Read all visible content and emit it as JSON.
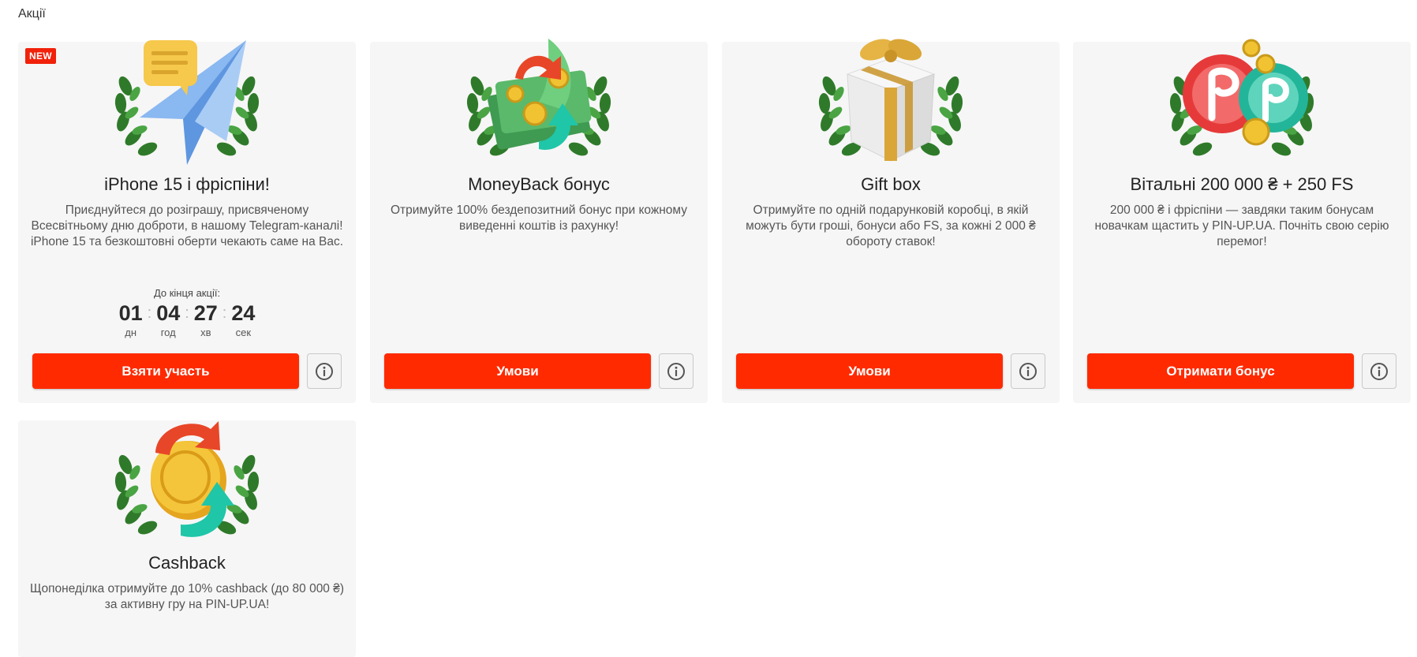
{
  "page": {
    "title": "Акції"
  },
  "badges": {
    "new": "NEW"
  },
  "colors": {
    "accent": "#ff2a00",
    "badge": "#f1210a",
    "card_bg": "#f6f6f6"
  },
  "promos": [
    {
      "title": "iPhone 15 і фріспіни!",
      "description": "Приєднуйтеся до розіграшу, присвяченому Всесвітньому дню доброти, в нашому Telegram-каналі! iPhone 15 та безкоштовні оберти чекають саме на Вас.",
      "button": "Взяти участь",
      "icon": "paper-plane-icon",
      "timer": {
        "label": "До кінця акції:",
        "days": "01",
        "hours": "04",
        "minutes": "27",
        "seconds": "24",
        "days_label": "дн",
        "hours_label": "год",
        "minutes_label": "хв",
        "seconds_label": "сек"
      }
    },
    {
      "title": "MoneyBack бонус",
      "description": "Отримуйте 100% бездепозитний бонус при кожному виведенні коштів із рахунку!",
      "button": "Умови",
      "icon": "money-stack-icon"
    },
    {
      "title": "Gift box",
      "description": "Отримуйте по одній подарунковій коробці, в якій можуть бути гроші, бонуси або FS, за кожні 2 000 ₴ обороту ставок!",
      "button": "Умови",
      "icon": "gift-box-icon"
    },
    {
      "title": "Вітальні 200 000 ₴ + 250 FS",
      "description": "200 000 ₴ і фріспіни — завдяки таким бонусам новачкам щастить у PIN-UP.UA. Почніть свою серію перемог!",
      "button": "Отримати бонус",
      "icon": "casino-chips-icon"
    },
    {
      "title": "Cashback",
      "description": "Щопонеділка отримуйте до 10% cashback (до 80 000 ₴) за активну гру на PIN-UP.UA!",
      "icon": "cashback-coin-icon"
    }
  ]
}
